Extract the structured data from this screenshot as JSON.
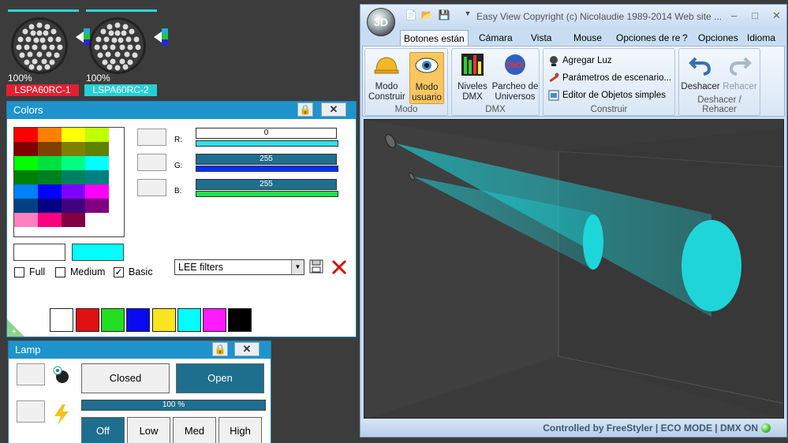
{
  "fixtures": [
    {
      "percent": "100%",
      "name": "LSPA60RC-1",
      "name_bg": "#e02131"
    },
    {
      "percent": "100%",
      "name": "LSPA60RC-2",
      "name_bg": "#27cfd4"
    }
  ],
  "colors_panel": {
    "title": "Colors",
    "palette": [
      [
        "#ff0000",
        "#ff8000",
        "#ffff00",
        "#c0ff00"
      ],
      [
        "#800000",
        "#804000",
        "#808000",
        "#608000"
      ],
      [
        "#00ff00",
        "#00e040",
        "#00ff80",
        "#00ffff"
      ],
      [
        "#008000",
        "#008020",
        "#008060",
        "#008080"
      ],
      [
        "#0080ff",
        "#0000ff",
        "#8000ff",
        "#ff00ff"
      ],
      [
        "#004080",
        "#000080",
        "#400080",
        "#800080"
      ],
      [
        "#ff80c0",
        "#ff0080",
        "#800040",
        "#ffffff"
      ]
    ],
    "swatch_left": "#ffffff",
    "swatch_right": "#00ffff",
    "checks": [
      {
        "label": "Full",
        "checked": false
      },
      {
        "label": "Medium",
        "checked": false
      },
      {
        "label": "Basic",
        "checked": true
      }
    ],
    "rgb": [
      {
        "label": "R:",
        "value": "0",
        "bar_color": "#2fe0e8"
      },
      {
        "label": "G:",
        "value": "255",
        "bar_color": "#0030ff"
      },
      {
        "label": "B:",
        "value": "255",
        "bar_color": "#20e050"
      }
    ],
    "filter_select": "LEE filters",
    "bottom_swatches": [
      "#ffffff",
      "#e21111",
      "#22dd22",
      "#0a0af0",
      "#f8e520",
      "#00ffff",
      "#ff1aff",
      "#000000"
    ]
  },
  "lamp_panel": {
    "title": "Lamp",
    "closed_label": "Closed",
    "open_label": "Open",
    "level": "100 %",
    "levels": [
      "Off",
      "Low",
      "Med",
      "High"
    ]
  },
  "easyview": {
    "title": "Easy View   Copyright (c) Nicolaudie 1989-2014   Web site ...",
    "tabs": [
      "Botones están",
      "Cámara",
      "Vista",
      "Mouse",
      "Opciones de re",
      "?",
      "Opciones",
      "Idioma"
    ],
    "modo": {
      "construir": "Modo Construir",
      "usuario": "Modo usuario",
      "label": "Modo"
    },
    "dmx": {
      "niveles": "Niveles DMX",
      "parcheo": "Parcheo de Universos",
      "label": "DMX"
    },
    "construir": {
      "agregar": "Agregar Luz",
      "parametros": "Parámetros de escenario...",
      "editor": "Editor de Objetos simples",
      "label": "Construir"
    },
    "deshacer": {
      "deshacer": "Deshacer",
      "rehacer": "Rehacer",
      "label": "Deshacer / Rehacer"
    },
    "status": "Controlled by FreeStyler  |  ECO MODE  |  DMX ON"
  }
}
